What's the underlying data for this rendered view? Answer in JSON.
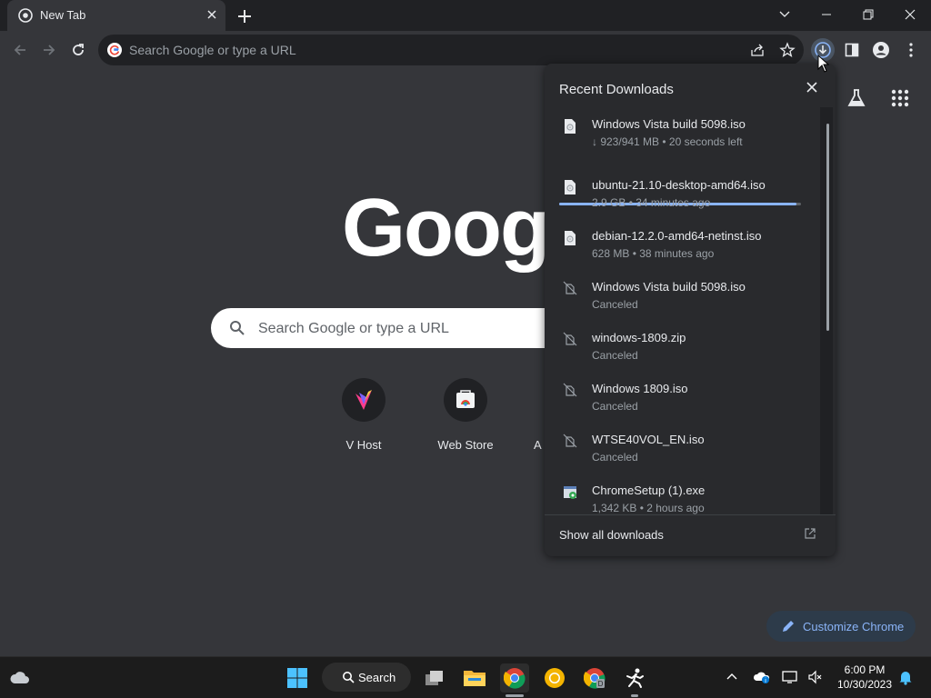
{
  "tab": {
    "title": "New Tab"
  },
  "omnibox": {
    "placeholder": "Search Google or type a URL"
  },
  "ntp": {
    "logo": "Googl",
    "search_placeholder": "Search Google or type a URL",
    "shortcuts": [
      {
        "label": "V Host"
      },
      {
        "label": "Web Store"
      },
      {
        "label": "Ac"
      }
    ],
    "customize_label": "Customize Chrome"
  },
  "downloads": {
    "title": "Recent Downloads",
    "items": [
      {
        "name": "Windows Vista build 5098.iso",
        "status": "↓ 923/941 MB • 20 seconds left",
        "state": "in_progress",
        "progress": 0.98
      },
      {
        "name": "ubuntu-21.10-desktop-amd64.iso",
        "status": "2.9 GB • 34 minutes ago",
        "state": "complete"
      },
      {
        "name": "debian-12.2.0-amd64-netinst.iso",
        "status": "628 MB • 38 minutes ago",
        "state": "complete"
      },
      {
        "name": "Windows Vista build 5098.iso",
        "status": "Canceled",
        "state": "canceled"
      },
      {
        "name": "windows-1809.zip",
        "status": "Canceled",
        "state": "canceled"
      },
      {
        "name": "Windows 1809.iso",
        "status": "Canceled",
        "state": "canceled"
      },
      {
        "name": "WTSE40VOL_EN.iso",
        "status": "Canceled",
        "state": "canceled"
      },
      {
        "name": "ChromeSetup (1).exe",
        "status": "1,342 KB • 2 hours ago",
        "state": "complete"
      }
    ],
    "footer_label": "Show all downloads"
  },
  "taskbar": {
    "search_label": "Search",
    "time": "6:00 PM",
    "date": "10/30/2023"
  },
  "colors": {
    "accent": "#8ab4f8",
    "frame": "#202124",
    "toolbar": "#35363a",
    "panel": "#292a2d"
  }
}
